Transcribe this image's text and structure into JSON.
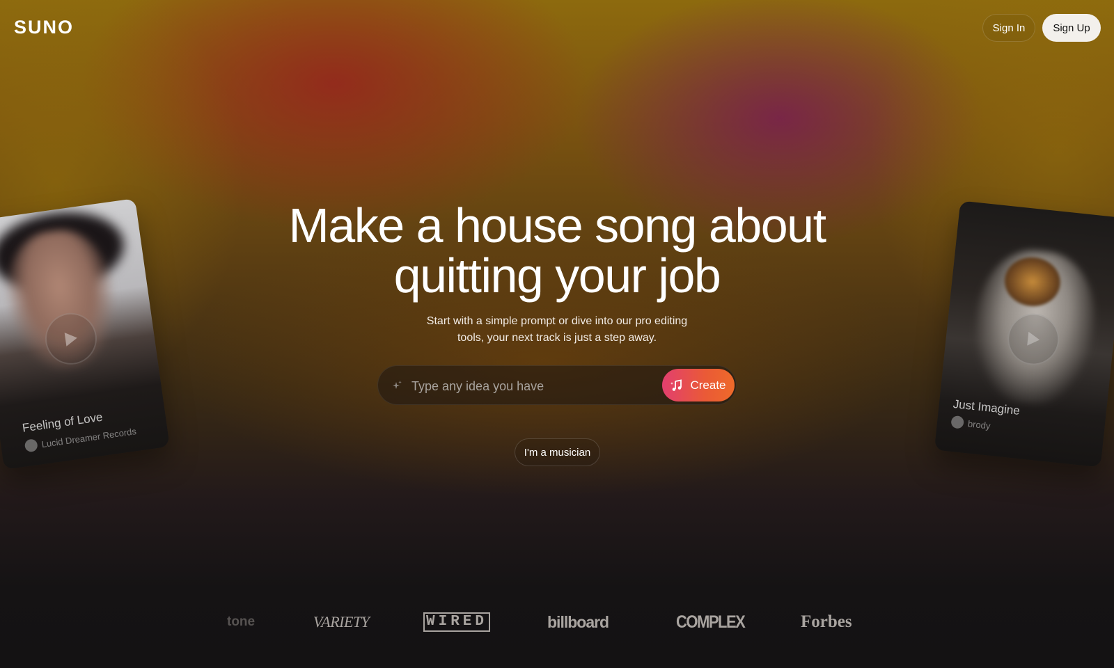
{
  "header": {
    "logo": "SUNO",
    "sign_in_label": "Sign In",
    "sign_up_label": "Sign Up"
  },
  "hero": {
    "title_line1": "Make a house song about",
    "title_line2": "quitting your job",
    "subtitle_line1": "Start with a simple prompt or dive into our pro editing",
    "subtitle_line2": "tools, your next track is just a step away."
  },
  "prompt": {
    "placeholder": "Type any idea you have",
    "value": "",
    "create_label": "Create",
    "sparkle_icon": "sparkle-icon",
    "create_icon": "music-note-icon"
  },
  "musician_button_label": "I'm a musician",
  "cards": [
    {
      "title": "Feeling of Love",
      "artist": "Lucid Dreamer Records"
    },
    {
      "title": "Just Imagine",
      "artist": "brody"
    }
  ],
  "press_logos": [
    "tone",
    "VARIETY",
    "WIRED",
    "billboard",
    "COMPLEX",
    "Forbes"
  ],
  "colors": {
    "create_gradient_start": "#e23f6f",
    "create_gradient_end": "#ee6a2a",
    "sign_up_bg": "#f3f0ec",
    "page_bottom": "#141213"
  }
}
